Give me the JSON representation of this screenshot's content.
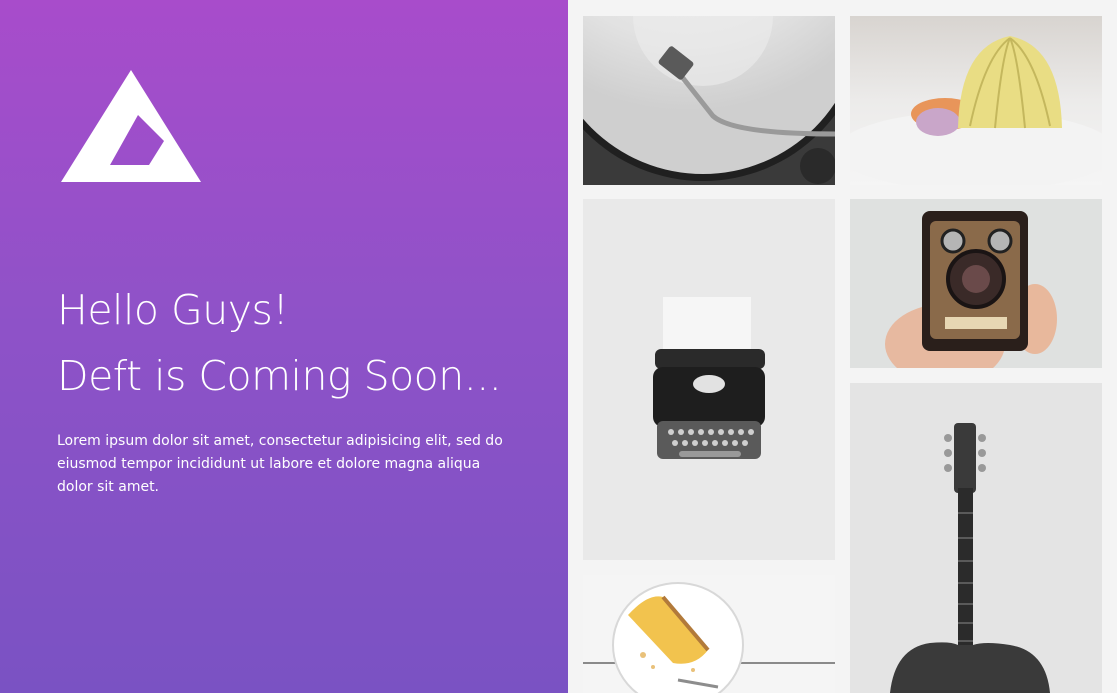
{
  "hero": {
    "heading_line1": "Hello Guys!",
    "heading_line2": "Deft is Coming Soon...",
    "description": "Lorem ipsum dolor sit amet, consectetur adipisicing elit, sed do eiusmod tempor incididunt ut labore et dolore magna aliqua dolor sit amet.",
    "gradient_top": "#a84ccb",
    "gradient_bottom": "#7a52c3",
    "logo_icon": "triangle-logo-icon"
  },
  "gallery": {
    "tiles": [
      {
        "subject": "turntable-record"
      },
      {
        "subject": "seashells"
      },
      {
        "subject": "typewriter"
      },
      {
        "subject": "vintage-camera"
      },
      {
        "subject": "acoustic-guitar"
      },
      {
        "subject": "cheesecake-plate"
      }
    ]
  }
}
